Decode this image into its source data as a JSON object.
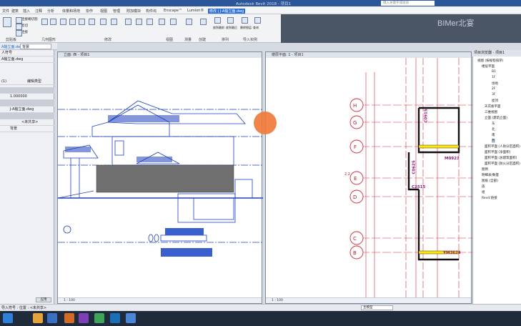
{
  "app": {
    "title": "Autodesk Revit 2018 -    项目1",
    "search_placeholder": "键入关键字或短语",
    "watermark": "BIMer北宴"
  },
  "menu": [
    "文件",
    "建筑",
    "插入",
    "注释",
    "分析",
    "体量和场地",
    "协作",
    "视图",
    "管理",
    "附加模块",
    "构件坞",
    "Enscape™",
    "Lumion®",
    "修改 | J-A轴立面.dwg"
  ],
  "ribbon": {
    "groups": [
      "剪贴板",
      "几何图形",
      "修改",
      "视图",
      "测量",
      "创建",
      "排列",
      "导入实例"
    ],
    "paste_items": [
      "连接端切割",
      "剪切",
      "连接"
    ],
    "place_items": [
      "放到最前",
      "放到最后",
      "删除图层",
      "查询"
    ]
  },
  "properties": {
    "rows": [
      "人符号",
      "A轴立面.dwg",
      "(1)",
      "1.000000",
      "J-A轴立面.dwg",
      "<未共享>",
      "背景"
    ],
    "type_button": "编辑类型",
    "apply_button": "应用",
    "top_field": "背景"
  },
  "views": {
    "left": {
      "title": "立面: 西 - 项目1",
      "scale": "1 : 100"
    },
    "right": {
      "title": "楼层平面: 1 - 项目1",
      "scale": "1 : 100"
    }
  },
  "plan": {
    "axis_labels": [
      "H",
      "G",
      "F",
      "E",
      "D",
      "C",
      "B"
    ],
    "door_tags": [
      "C0915",
      "C0625",
      "M0921",
      "C2515",
      "YM3624"
    ],
    "dimension": "2.2"
  },
  "browser": {
    "title": "项目浏览器 - 项目1",
    "items": [
      "视图 (按规程排序)",
      "楼层平面",
      "B1",
      "1F",
      "场地",
      "2F",
      "3F",
      "屋顶",
      "天花板平面",
      "三维视图",
      "立面 (建筑立面)",
      "东",
      "北",
      "南",
      "西",
      "面积平面 (人防分区面积)",
      "面积平面 (净面积)",
      "面积平面 (总建筑面积)",
      "面积平面 (防火分区面积)",
      "图例",
      "明细表/数量",
      "图纸 (全部)",
      "族",
      "组",
      "Revit 链接"
    ]
  },
  "status": {
    "left": "导入符号 : 位置 : <未共享>",
    "mid": "主模型"
  },
  "colors": {
    "accent": "#2b579a",
    "drawing_blue": "#1f3fbf",
    "plan_red": "#d42a3a",
    "tag_magenta": "#8e1a78",
    "grip_orange": "#f07b3a"
  }
}
